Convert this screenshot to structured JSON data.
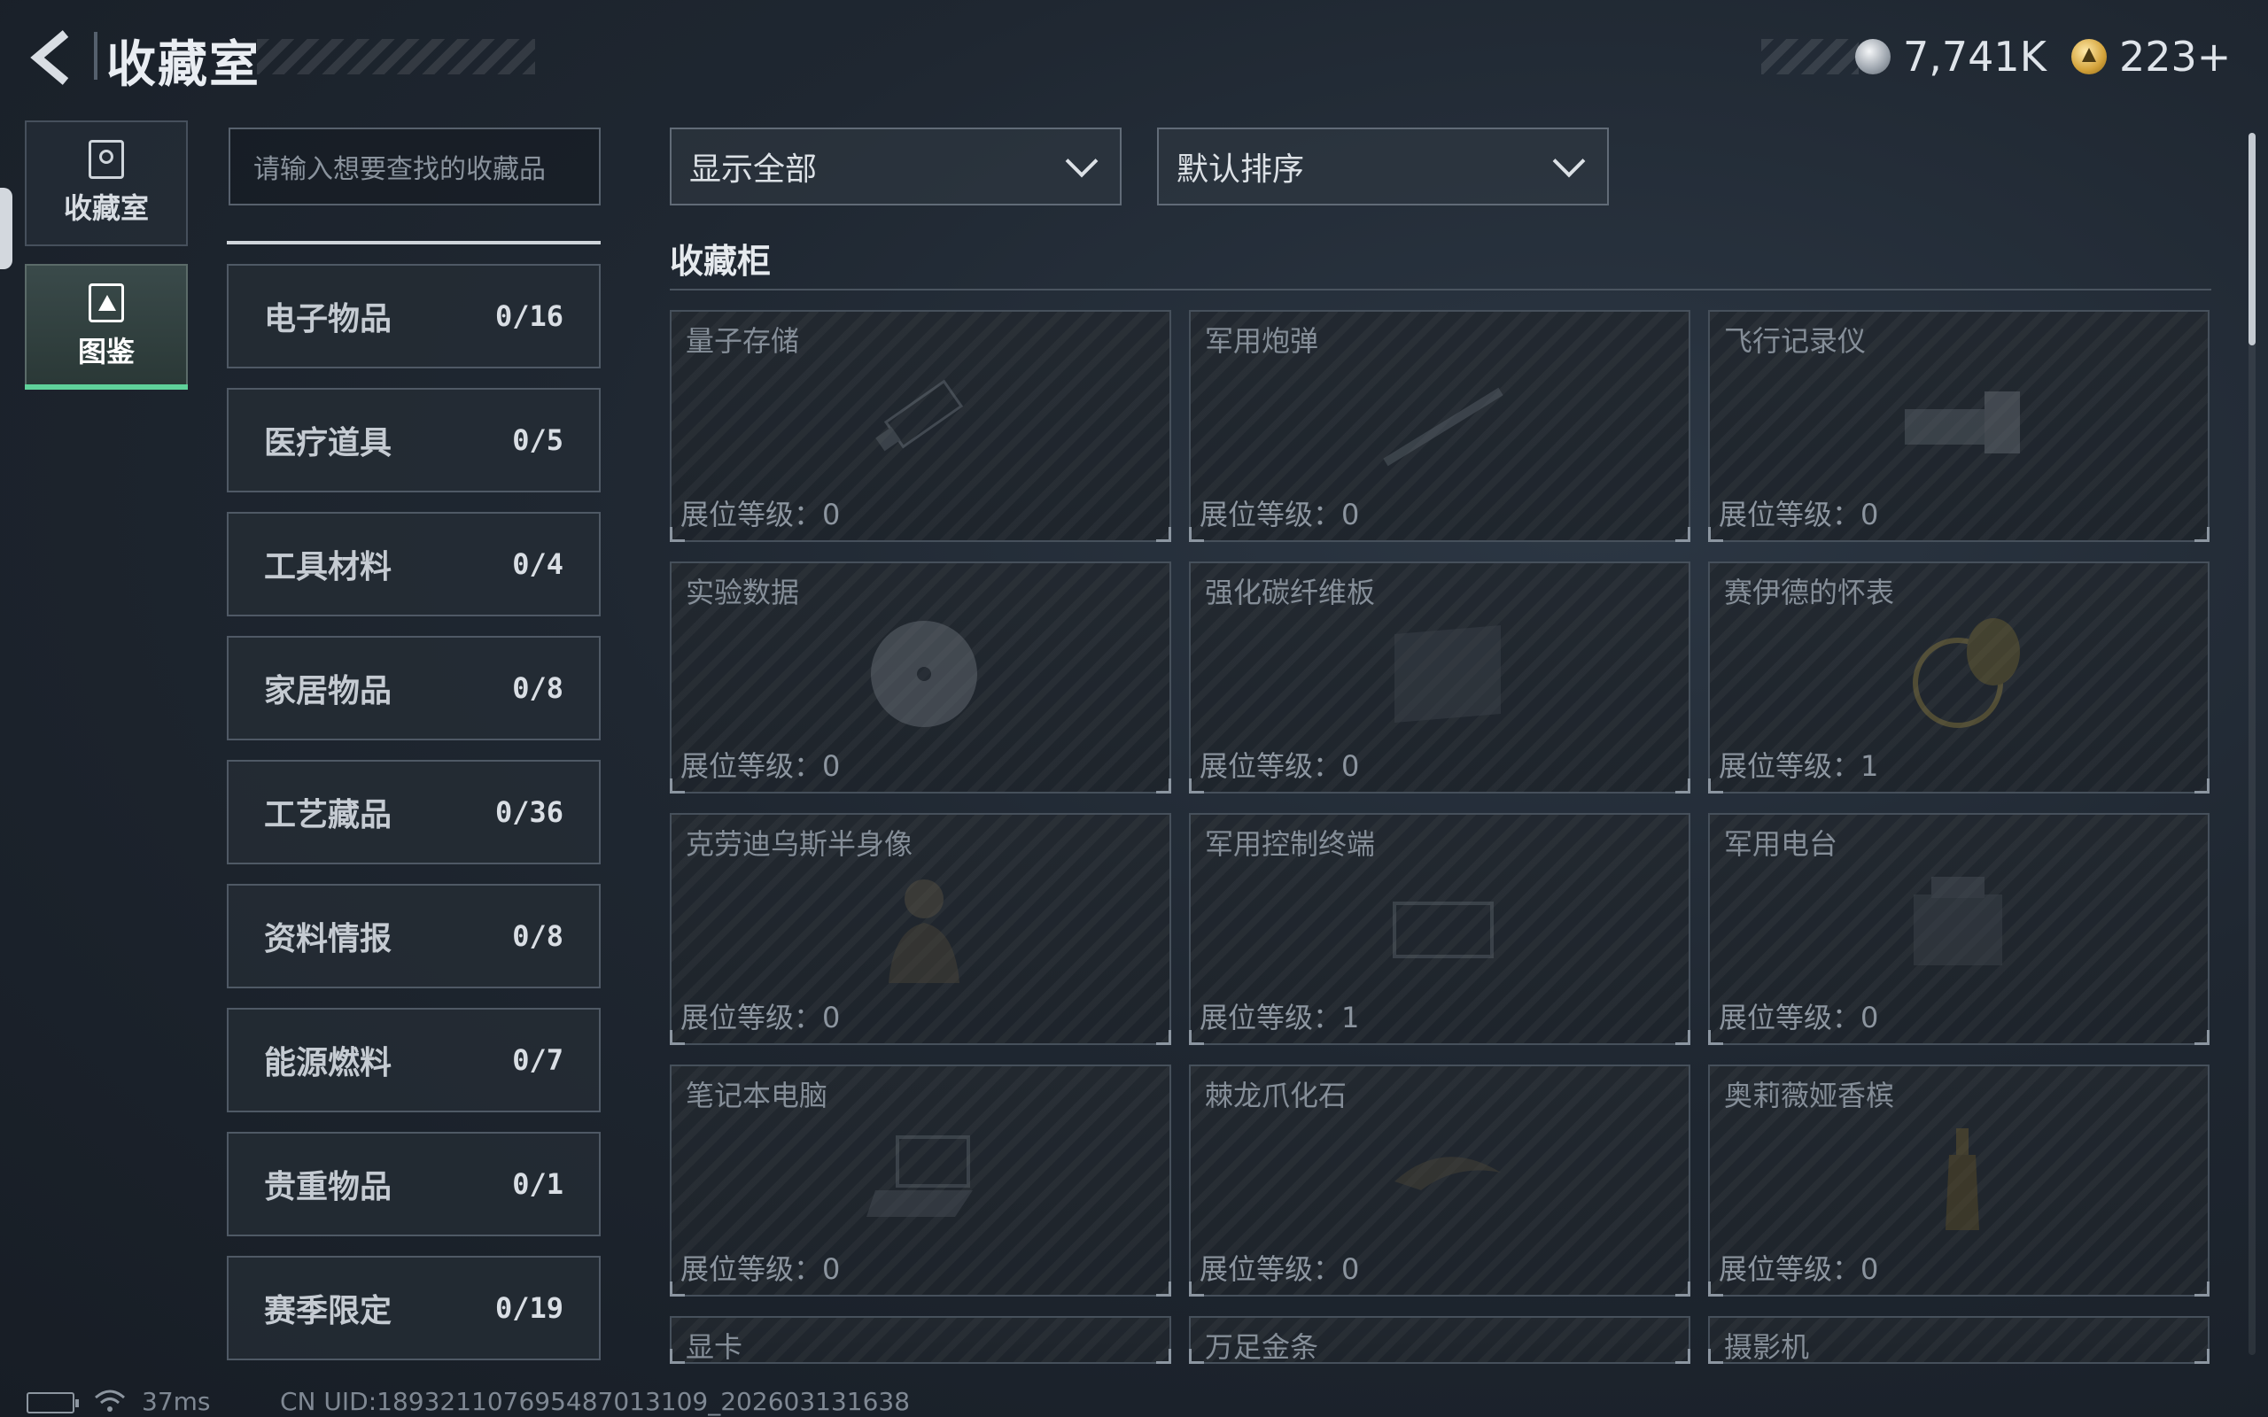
{
  "header": {
    "title": "收藏室",
    "currencies": [
      {
        "icon": "silver-coin-icon",
        "amount": "7,741K"
      },
      {
        "icon": "gold-coin-icon",
        "amount": "223+"
      }
    ]
  },
  "nav": {
    "tabs": [
      {
        "label": "收藏室",
        "icon": "trophy-case-icon",
        "active": false
      },
      {
        "label": "图鉴",
        "icon": "codex-icon",
        "active": true
      }
    ]
  },
  "search": {
    "placeholder": "请输入想要查找的收藏品"
  },
  "categories": [
    {
      "name": "电子物品",
      "count": "0/16"
    },
    {
      "name": "医疗道具",
      "count": "0/5"
    },
    {
      "name": "工具材料",
      "count": "0/4"
    },
    {
      "name": "家居物品",
      "count": "0/8"
    },
    {
      "name": "工艺藏品",
      "count": "0/36"
    },
    {
      "name": "资料情报",
      "count": "0/8"
    },
    {
      "name": "能源燃料",
      "count": "0/7"
    },
    {
      "name": "贵重物品",
      "count": "0/1"
    },
    {
      "name": "赛季限定",
      "count": "0/19"
    }
  ],
  "filters": {
    "display": "显示全部",
    "sort": "默认排序"
  },
  "section": {
    "title": "收藏柜"
  },
  "items": [
    {
      "name": "量子存储",
      "level": "展位等级：0"
    },
    {
      "name": "军用炮弹",
      "level": "展位等级：0"
    },
    {
      "name": "飞行记录仪",
      "level": "展位等级：0"
    },
    {
      "name": "实验数据",
      "level": "展位等级：0"
    },
    {
      "name": "强化碳纤维板",
      "level": "展位等级：0"
    },
    {
      "name": "赛伊德的怀表",
      "level": "展位等级：1"
    },
    {
      "name": "克劳迪乌斯半身像",
      "level": "展位等级：0"
    },
    {
      "name": "军用控制终端",
      "level": "展位等级：1"
    },
    {
      "name": "军用电台",
      "level": "展位等级：0"
    },
    {
      "name": "笔记本电脑",
      "level": "展位等级：0"
    },
    {
      "name": "棘龙爪化石",
      "level": "展位等级：0"
    },
    {
      "name": "奥莉薇娅香槟",
      "level": "展位等级：0"
    },
    {
      "name": "显卡",
      "level": ""
    },
    {
      "name": "万足金条",
      "level": ""
    },
    {
      "name": "摄影机",
      "level": ""
    }
  ],
  "footer": {
    "ping": "37ms",
    "uid": "CN UID:189321107695487013109_202603131638"
  },
  "colors": {
    "accent_green": "#5fd19a",
    "background": "#1f2731"
  }
}
